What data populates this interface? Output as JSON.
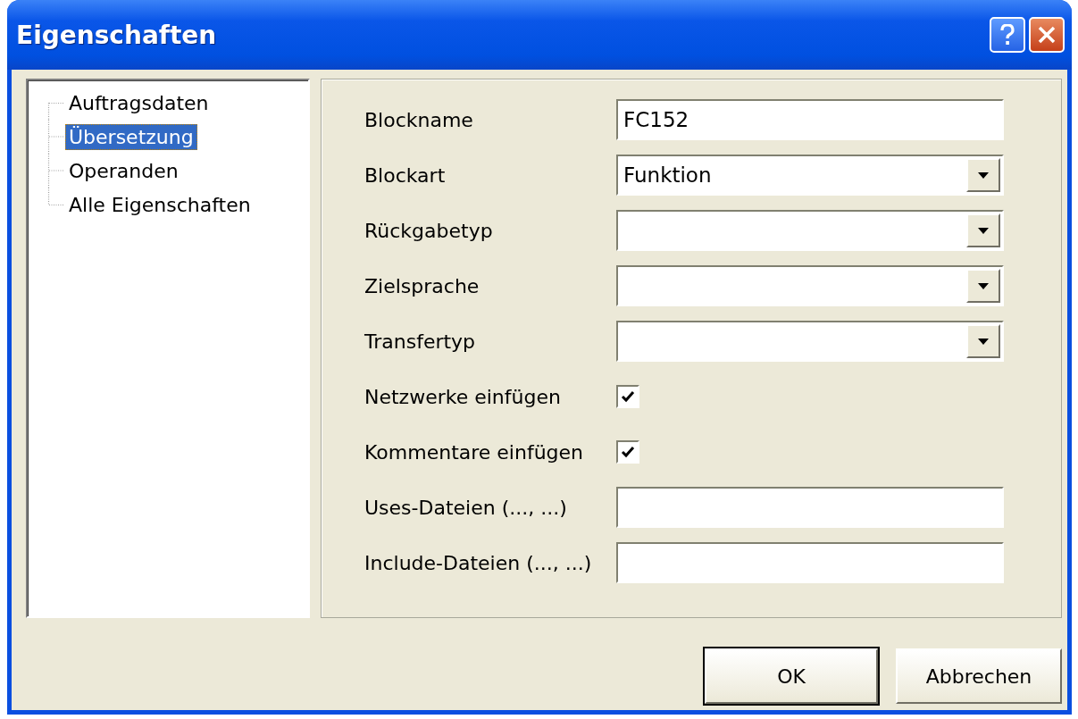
{
  "window": {
    "title": "Eigenschaften"
  },
  "tree": [
    {
      "label": "Auftragsdaten",
      "selected": false
    },
    {
      "label": "Übersetzung",
      "selected": true
    },
    {
      "label": "Operanden",
      "selected": false
    },
    {
      "label": "Alle Eigenschaften",
      "selected": false
    }
  ],
  "fields": [
    {
      "kind": "text",
      "label": "Blockname",
      "value": "FC152"
    },
    {
      "kind": "dropdown",
      "label": "Blockart",
      "value": "Funktion"
    },
    {
      "kind": "dropdown",
      "label": "Rückgabetyp"
    },
    {
      "kind": "dropdown",
      "label": "Zielsprache"
    },
    {
      "kind": "dropdown",
      "label": "Transfertyp"
    },
    {
      "kind": "checkbox",
      "label": "Netzwerke einfügen",
      "checked": true
    },
    {
      "kind": "checkbox",
      "label": "Kommentare einfügen",
      "checked": true
    },
    {
      "kind": "text",
      "label": "Uses-Dateien (..., ...)"
    },
    {
      "kind": "text",
      "label": "Include-Dateien (..., ...)"
    }
  ],
  "buttons": [
    {
      "label": "OK",
      "default": true
    },
    {
      "label": "Abbrechen",
      "default": false
    }
  ]
}
